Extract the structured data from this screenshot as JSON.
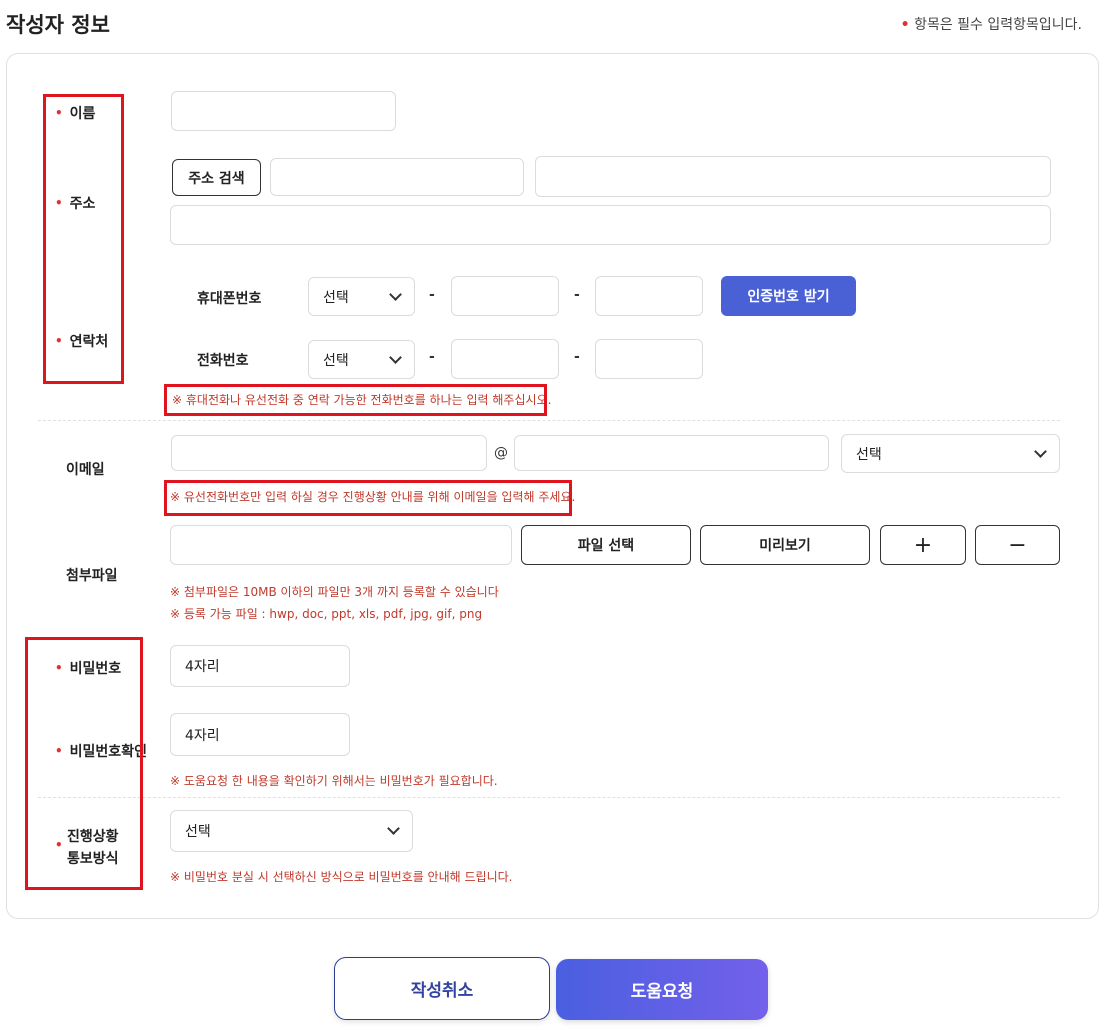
{
  "header": {
    "title": "작성자 정보",
    "required_mark": "•",
    "required_note": "항목은 필수 입력항목입니다."
  },
  "labels": {
    "name": "이름",
    "address": "주소",
    "contact": "연락처",
    "email": "이메일",
    "attachment": "첨부파일",
    "password": "비밀번호",
    "password_confirm": "비밀번호확인",
    "progress_line1": "진행상황",
    "progress_line2": "통보방식"
  },
  "address": {
    "search_button": "주소 검색"
  },
  "contact": {
    "mobile_label": "휴대폰번호",
    "phone_label": "전화번호",
    "select_placeholder": "선택",
    "dash": "-",
    "verify_button": "인증번호 받기",
    "notice": "※ 휴대전화나 유선전화 중 연락 가능한 전화번호를 하나는 입력 해주십시오."
  },
  "email": {
    "at": "@",
    "domain_select": "선택",
    "notice": "※ 유선전화번호만 입력 하실 경우 진행상황 안내를 위해 이메일을 입력해 주세요."
  },
  "attachment": {
    "select_file_button": "파일 선택",
    "preview_button": "미리보기",
    "add_button": "+",
    "remove_button": "−",
    "notice1": "※ 첨부파일은 10MB 이하의 파일만 3개 까지 등록할 수 있습니다",
    "notice2": "※ 등록 가능 파일 : hwp, doc, ppt, xls, pdf, jpg, gif, png"
  },
  "password": {
    "placeholder": "4자리",
    "confirm_placeholder": "4자리",
    "notice": "※ 도움요청 한 내용을 확인하기 위해서는 비밀번호가 필요합니다."
  },
  "progress": {
    "select_value": "선택",
    "notice": "※ 비밀번호 분실 시 선택하신 방식으로 비밀번호를 안내해 드립니다."
  },
  "actions": {
    "cancel": "작성취소",
    "submit": "도움요청"
  },
  "colors": {
    "required_dot": "#d33333",
    "notice_text": "#c0392b",
    "primary": "#4a61d6",
    "highlight_box": "#e0141e"
  }
}
